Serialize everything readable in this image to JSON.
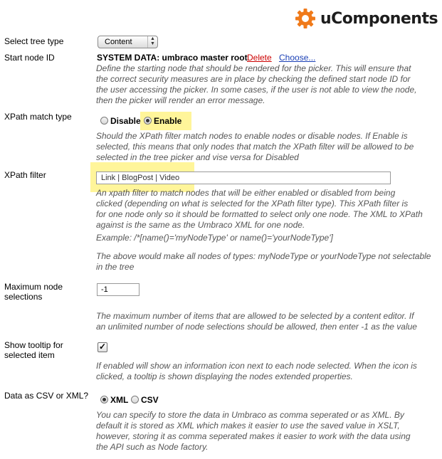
{
  "brand": {
    "name": "uComponents",
    "gear_color": "#f07a1a"
  },
  "fields": {
    "tree_type": {
      "label": "Select tree type",
      "value": "Content"
    },
    "start_node": {
      "label": "Start node ID",
      "value": "SYSTEM DATA: umbraco master root",
      "delete_label": "Delete",
      "choose_label": "Choose...",
      "description": [
        "Define the starting node that should be rendered for the picker. This will ensure that",
        "the correct security measures are in place by checking the defined start node ID for",
        "the user accessing the picker. In some cases, if the user is not able to view the node,",
        "then the picker will render an error message."
      ]
    },
    "xpath_match": {
      "label": "XPath match type",
      "options": [
        "Disable",
        "Enable"
      ],
      "selected": "Enable",
      "description": [
        "Should the XPath filter match nodes to enable nodes or disable nodes. If Enable is",
        "selected, this means that only nodes that match the XPath filter will be allowed to be",
        "selected in the tree picker and vise versa for Disabled"
      ]
    },
    "xpath_filter": {
      "label": "XPath filter",
      "value": "Link | BlogPost | Video",
      "description": [
        "An xpath filter to match nodes that will be either enabled or disabled from being",
        "clicked (depending on what is selected for the XPath filter type). This XPath filter is",
        "for one node only so it should be formatted to select only one node. The XML to XPath",
        "against is the same as the Umbraco XML for one node."
      ],
      "example": "Example: /*[name()='myNodeType' or name()='yourNodeType']",
      "note": [
        "The above would make all nodes of types: myNodeType or yourNodeType not selectable",
        "in the tree"
      ]
    },
    "max_nodes": {
      "label_line1": "Maximum node",
      "label_line2": "selections",
      "value": "-1",
      "description": [
        "The maximum number of items that are allowed to be selected by a content editor. If",
        "an unlimited number of node selections should be allowed, then enter -1 as the value"
      ]
    },
    "tooltip": {
      "label_line1": "Show tooltip for",
      "label_line2": "selected item",
      "checked_glyph": "✓",
      "description": [
        "If enabled will show an information icon next to each node selected. When the icon is",
        "clicked, a tooltip is shown displaying the nodes extended properties."
      ]
    },
    "data_format": {
      "label": "Data as CSV or XML?",
      "options": [
        "XML",
        "CSV"
      ],
      "selected": "XML",
      "description": [
        "You can specify to store the data in Umbraco as comma seperated or as XML. By",
        "default it is stored as XML which makes it easier to use the saved value in XSLT,",
        "however, storing it as comma seperated makes it easier to work with the data using",
        "the API such as Node factory."
      ]
    }
  },
  "colors": {
    "highlight": "#fff59a",
    "delete_link": "#cc0000",
    "choose_link": "#1a3fb5"
  }
}
